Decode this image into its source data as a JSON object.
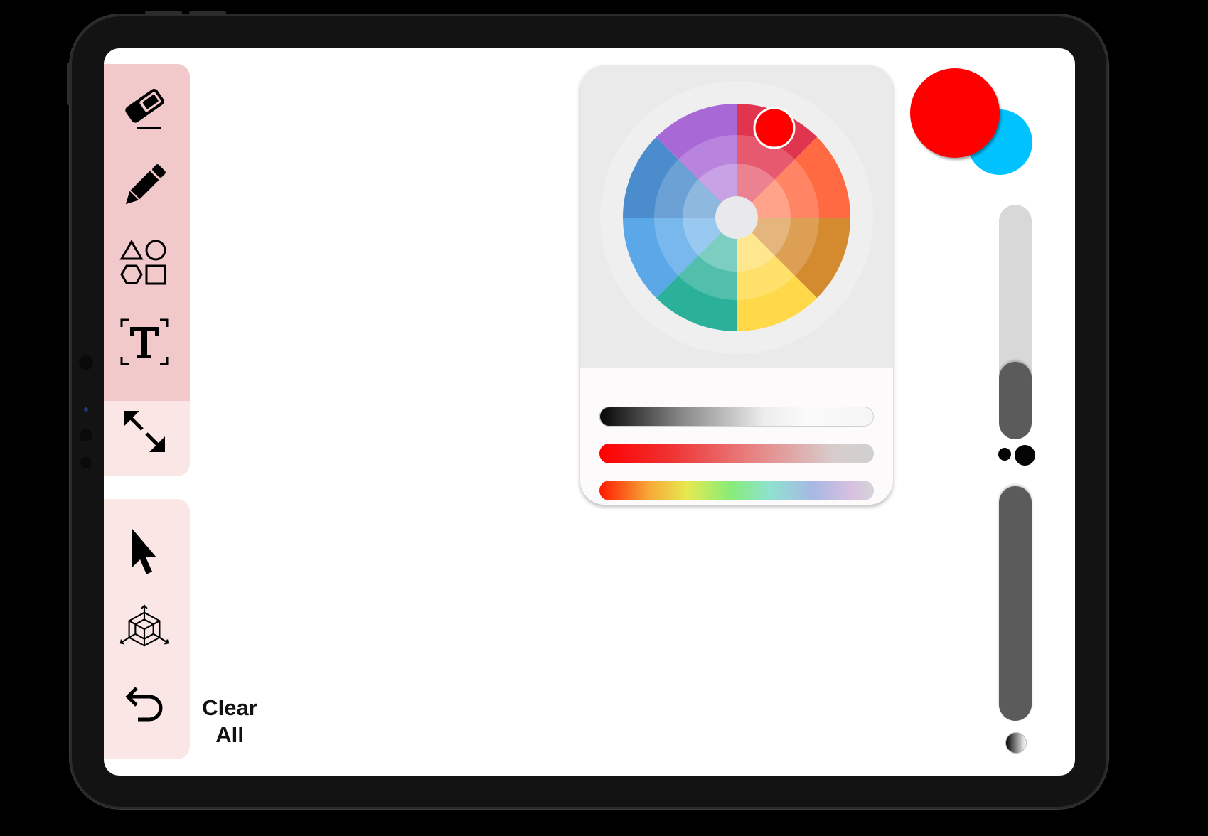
{
  "toolbar_top": {
    "tools": [
      {
        "name": "eraser",
        "icon": "eraser-icon"
      },
      {
        "name": "pencil",
        "icon": "pencil-icon"
      },
      {
        "name": "shapes",
        "icon": "shapes-icon"
      },
      {
        "name": "text",
        "icon": "text-icon"
      },
      {
        "name": "resize",
        "icon": "expand-arrows-icon"
      }
    ]
  },
  "toolbar_bottom": {
    "tools": [
      {
        "name": "select",
        "icon": "cursor-icon"
      },
      {
        "name": "3d",
        "icon": "cube-3d-icon"
      },
      {
        "name": "undo",
        "icon": "undo-icon"
      }
    ],
    "clear_all_label": "Clear\nAll"
  },
  "colors": {
    "primary": "#ff0000",
    "secondary": "#00c2ff",
    "toolbar_active_bg": "#f2c9ca",
    "toolbar_bg": "#fbe6e6",
    "slider_dark": "#5b5b5b",
    "slider_light": "#d8d8d8"
  },
  "color_wheel": {
    "segments": [
      "#e0344f",
      "#ff6a42",
      "#d48a2e",
      "#ffd94a",
      "#2bb19a",
      "#5aa8e8",
      "#4a8ccc",
      "#a869d6"
    ],
    "selected_color": "#ff0000"
  },
  "sliders": {
    "brush_size_fraction": 0.33,
    "opacity_fraction": 1.0
  }
}
